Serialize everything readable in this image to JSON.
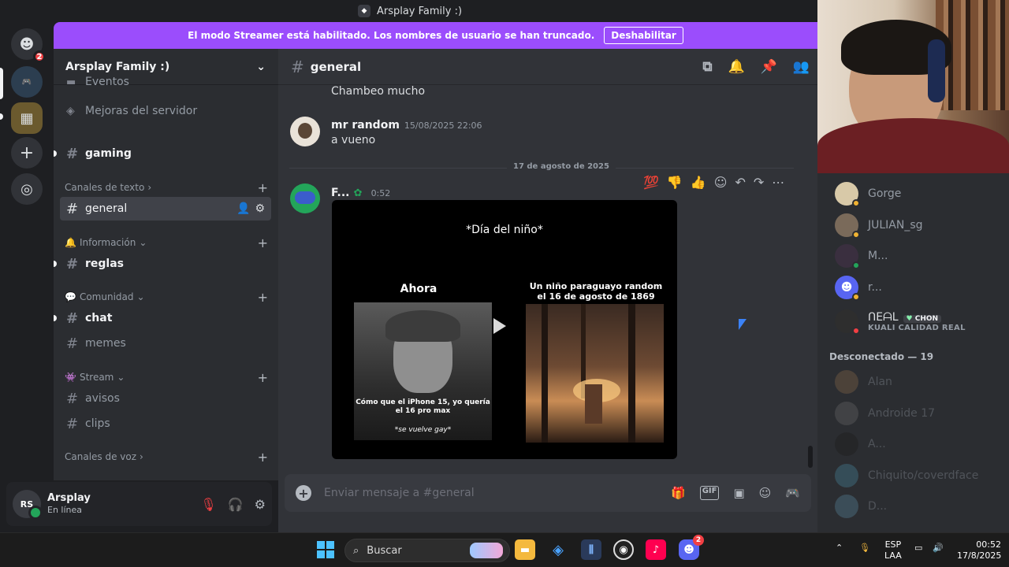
{
  "window": {
    "title": "Arsplay Family :)"
  },
  "rail": {
    "home_badge": "2"
  },
  "banner": {
    "text": "El modo Streamer está habilitado. Los nombres de usuario se han truncado.",
    "button": "Deshabilitar"
  },
  "sidebar": {
    "server_name": "Arsplay Family :)",
    "top_items": [
      {
        "label": "Eventos"
      },
      {
        "label": "Mejoras del servidor"
      }
    ],
    "channels": {
      "gaming": "gaming",
      "general": "general",
      "reglas": "reglas",
      "chat": "chat",
      "memes": "memes",
      "avisos": "avisos",
      "clips": "clips"
    },
    "categories": {
      "texto": "Canales de texto",
      "info": "Información",
      "comunidad": "Comunidad",
      "stream": "Stream",
      "voz": "Canales de voz"
    }
  },
  "user": {
    "name": "Arsplay",
    "status": "En línea",
    "avatar_text": "RS"
  },
  "chat": {
    "channel": "general",
    "messages": [
      {
        "text": "Chambeo mucho"
      },
      {
        "author": "mr random",
        "time": "15/08/2025 22:06",
        "text": "a vueno"
      }
    ],
    "date_divider": "17 de agosto de 2025",
    "video_message": {
      "author": "F...",
      "time": "0:52",
      "video_title": "*Día del niño*",
      "left_label": "Ahora",
      "right_label": "Un niño paraguayo random el 16 de agosto de 1869",
      "caption": "Cómo que el iPhone 15, yo quería el 16 pro max",
      "caption2": "*se vuelve gay*"
    },
    "reactions": [
      "💯",
      "👎",
      "👍"
    ],
    "composer_placeholder": "Enviar mensaje a #general"
  },
  "members": {
    "online": [
      {
        "name": "Gorge"
      },
      {
        "name": "JULIAN_sg"
      },
      {
        "name": "M..."
      },
      {
        "name": "r..."
      },
      {
        "name": "ᑎEᗩᒪ",
        "tag": "CHON",
        "sub": "KUALI CALIDAD REAL"
      }
    ],
    "offline_header": "Desconectado — 19",
    "offline": [
      {
        "name": "Alan"
      },
      {
        "name": "Androide 17"
      },
      {
        "name": "A..."
      },
      {
        "name": "Chiquito/coverdface"
      },
      {
        "name": "D..."
      }
    ]
  },
  "taskbar": {
    "search": "Buscar",
    "discord_badge": "2",
    "lang1": "ESP",
    "lang2": "LAA",
    "time": "00:52",
    "date": "17/8/2025"
  },
  "colors": {
    "streamer_banner": "#9b4dfc",
    "online": "#23a55a",
    "accent": "#5865f2"
  }
}
